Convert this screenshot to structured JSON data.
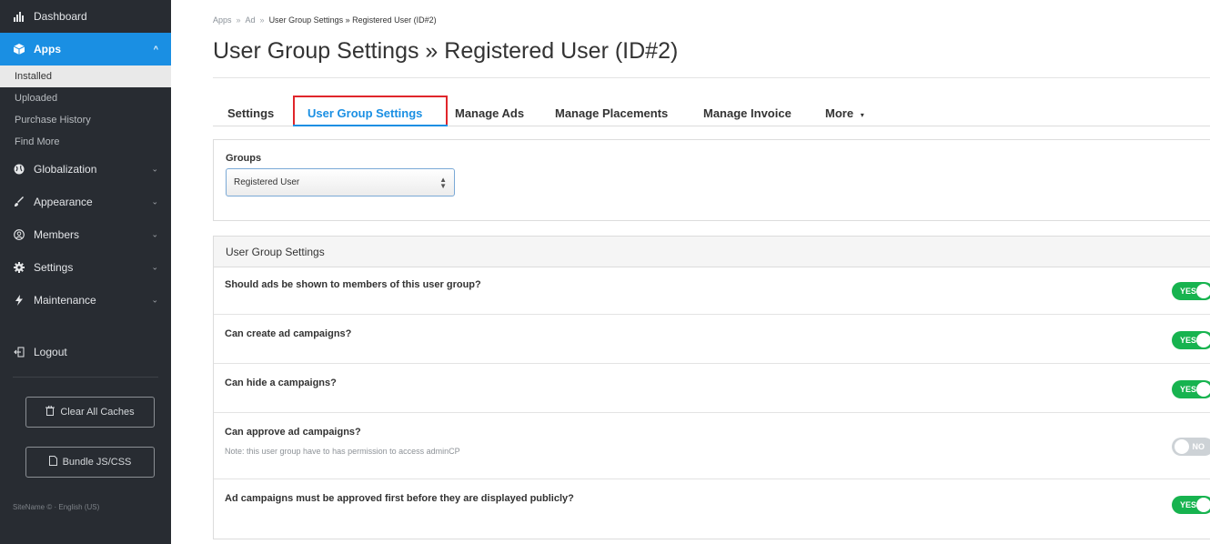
{
  "sidebar": {
    "dashboard": {
      "label": "Dashboard",
      "icon": "bar-chart-icon"
    },
    "apps": {
      "label": "Apps",
      "icon": "cube-icon"
    },
    "apps_sub": [
      {
        "label": "Installed"
      },
      {
        "label": "Uploaded"
      },
      {
        "label": "Purchase History"
      },
      {
        "label": "Find More"
      }
    ],
    "globalization": {
      "label": "Globalization",
      "icon": "globe-icon"
    },
    "appearance": {
      "label": "Appearance",
      "icon": "paint-brush-icon"
    },
    "members": {
      "label": "Members",
      "icon": "user-circle-icon"
    },
    "settings": {
      "label": "Settings",
      "icon": "gear-icon"
    },
    "maintenance": {
      "label": "Maintenance",
      "icon": "bolt-icon"
    },
    "logout": {
      "label": "Logout",
      "icon": "logout-icon"
    },
    "clear_caches": {
      "label": "Clear All Caches",
      "icon": "trash-icon"
    },
    "bundle": {
      "label": "Bundle JS/CSS",
      "icon": "file-icon"
    },
    "sitename": "SiteName © · English (US)"
  },
  "breadcrumb": {
    "items": [
      "Apps",
      "Ad"
    ],
    "current": "User Group Settings » Registered User (ID#2)"
  },
  "page_title": "User Group Settings » Registered User (ID#2)",
  "tabs": [
    {
      "label": "Settings"
    },
    {
      "label": "User Group Settings"
    },
    {
      "label": "Manage Ads"
    },
    {
      "label": "Manage Placements"
    },
    {
      "label": "Manage Invoice"
    },
    {
      "label": "More"
    }
  ],
  "groups": {
    "label": "Groups",
    "selected": "Registered User"
  },
  "panel": {
    "title": "User Group Settings",
    "rows": [
      {
        "label": "Should ads be shown to members of this user group?",
        "note": "",
        "toggle": "YES"
      },
      {
        "label": "Can create ad campaigns?",
        "note": "",
        "toggle": "YES"
      },
      {
        "label": "Can hide a campaigns?",
        "note": "",
        "toggle": "YES"
      },
      {
        "label": "Can approve ad campaigns?",
        "note": "Note: this user group have to has permission to access adminCP",
        "toggle": "NO"
      },
      {
        "label": "Ad campaigns must be approved first before they are displayed publicly?",
        "note": "",
        "toggle": "YES"
      }
    ]
  },
  "colors": {
    "sidebar_bg": "#282c32",
    "accent": "#1a8fe3",
    "toggle_on": "#17b34f",
    "toggle_off": "#cdd2d6",
    "highlight": "#e0262b"
  }
}
